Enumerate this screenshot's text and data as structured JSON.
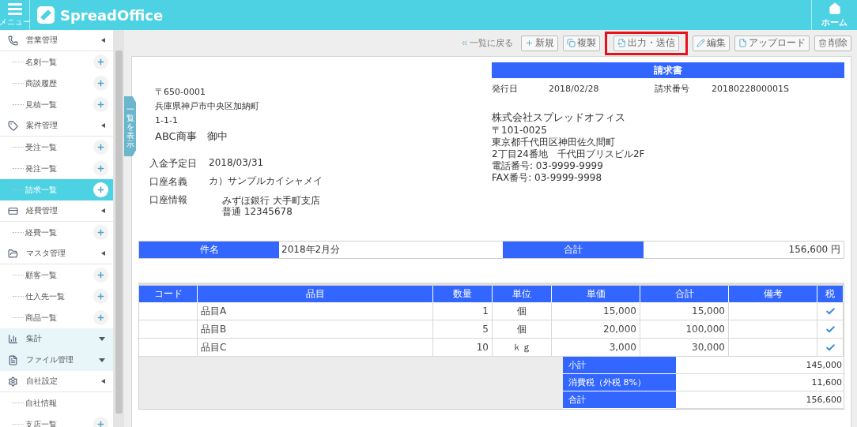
{
  "header": {
    "menu_label": "メニュー",
    "logo": "SpreadOffice",
    "home_label": "ホーム"
  },
  "sidebar": {
    "sections": [
      {
        "label": "営業管理",
        "kind": "phone",
        "expanded": true,
        "items": [
          {
            "label": "名刺一覧",
            "selected": false
          },
          {
            "label": "商談履歴",
            "selected": false
          },
          {
            "label": "見積一覧",
            "selected": false
          }
        ]
      },
      {
        "label": "案件管理",
        "kind": "tag",
        "expanded": true,
        "items": [
          {
            "label": "受注一覧",
            "selected": false
          },
          {
            "label": "発注一覧",
            "selected": false
          },
          {
            "label": "請求一覧",
            "selected": true
          }
        ]
      },
      {
        "label": "経費管理",
        "kind": "card",
        "expanded": true,
        "items": [
          {
            "label": "経費一覧",
            "selected": false
          }
        ]
      },
      {
        "label": "マスタ管理",
        "kind": "folder",
        "expanded": true,
        "items": [
          {
            "label": "顧客一覧",
            "selected": false
          },
          {
            "label": "仕入先一覧",
            "selected": false
          },
          {
            "label": "商品一覧",
            "selected": false
          }
        ]
      },
      {
        "label": "集計",
        "kind": "chart",
        "expanded": false
      },
      {
        "label": "ファイル管理",
        "kind": "file",
        "expanded": false
      },
      {
        "label": "自社設定",
        "kind": "gear",
        "expanded": true,
        "items": [
          {
            "label": "自社情報",
            "selected": false,
            "kind": "plain"
          },
          {
            "label": "支店一覧",
            "selected": false
          }
        ]
      }
    ]
  },
  "side_tab": "一覧を表示",
  "toolbar": {
    "back_link": "一覧に戻る",
    "buttons": [
      {
        "label": "新規",
        "kind": "new",
        "highlighted": false
      },
      {
        "label": "複製",
        "kind": "copy",
        "highlighted": false
      },
      {
        "label": "出力・送信",
        "kind": "output",
        "highlighted": true
      },
      {
        "label": "編集",
        "kind": "edit",
        "highlighted": false
      },
      {
        "label": "アップロード",
        "kind": "upload",
        "highlighted": false
      },
      {
        "label": "削除",
        "kind": "delete",
        "highlighted": false
      }
    ]
  },
  "document": {
    "recipient": {
      "postal": "〒650-0001",
      "address": "兵庫県神戸市中央区加納町",
      "address2": "1-1-1",
      "name": "ABC商事　御中"
    },
    "payment": [
      {
        "label": "入金予定日",
        "lines": [
          "2018/03/31"
        ]
      },
      {
        "label": "口座名義",
        "lines": [
          "カ）サンプルカイシャメイ"
        ]
      },
      {
        "label": "口座情報",
        "lines": [
          "みずほ銀行 大手町支店",
          "普通 12345678"
        ],
        "kind": "indented"
      }
    ],
    "title": "請求書",
    "meta": [
      {
        "label": "発行日",
        "value": "2018/02/28"
      },
      {
        "label": "請求番号",
        "value": "2018022800001S"
      }
    ],
    "sender": {
      "name": "株式会社スプレッドオフィス",
      "lines": [
        "〒101-0025",
        "東京都千代田区神田佐久間町",
        "2丁目24番地　千代田ブリスビル2F",
        "電話番号:  03-9999-9999",
        "FAX番号:  03-9999-9998"
      ]
    },
    "subject": {
      "label": "件名",
      "value": "2018年2月分",
      "total_label": "合計",
      "total_value": "156,600 円"
    },
    "items": {
      "columns": [
        "コード",
        "品目",
        "数量",
        "単位",
        "単価",
        "合計",
        "備考",
        "税"
      ],
      "rows": [
        {
          "name": "品目A",
          "qty": "1",
          "unit": "個",
          "price": "15,000",
          "total": "15,000",
          "taxed": true
        },
        {
          "name": "品目B",
          "qty": "5",
          "unit": "個",
          "price": "20,000",
          "total": "100,000",
          "taxed": true
        },
        {
          "name": "品目C",
          "qty": "10",
          "unit": "ｋｇ",
          "price": "3,000",
          "total": "30,000",
          "taxed": true
        }
      ]
    },
    "summary": [
      {
        "label": "小計",
        "value": "145,000"
      },
      {
        "label": "消費税（外税 8%）",
        "value": "11,600"
      },
      {
        "label": "合計",
        "value": "156,600"
      }
    ]
  }
}
